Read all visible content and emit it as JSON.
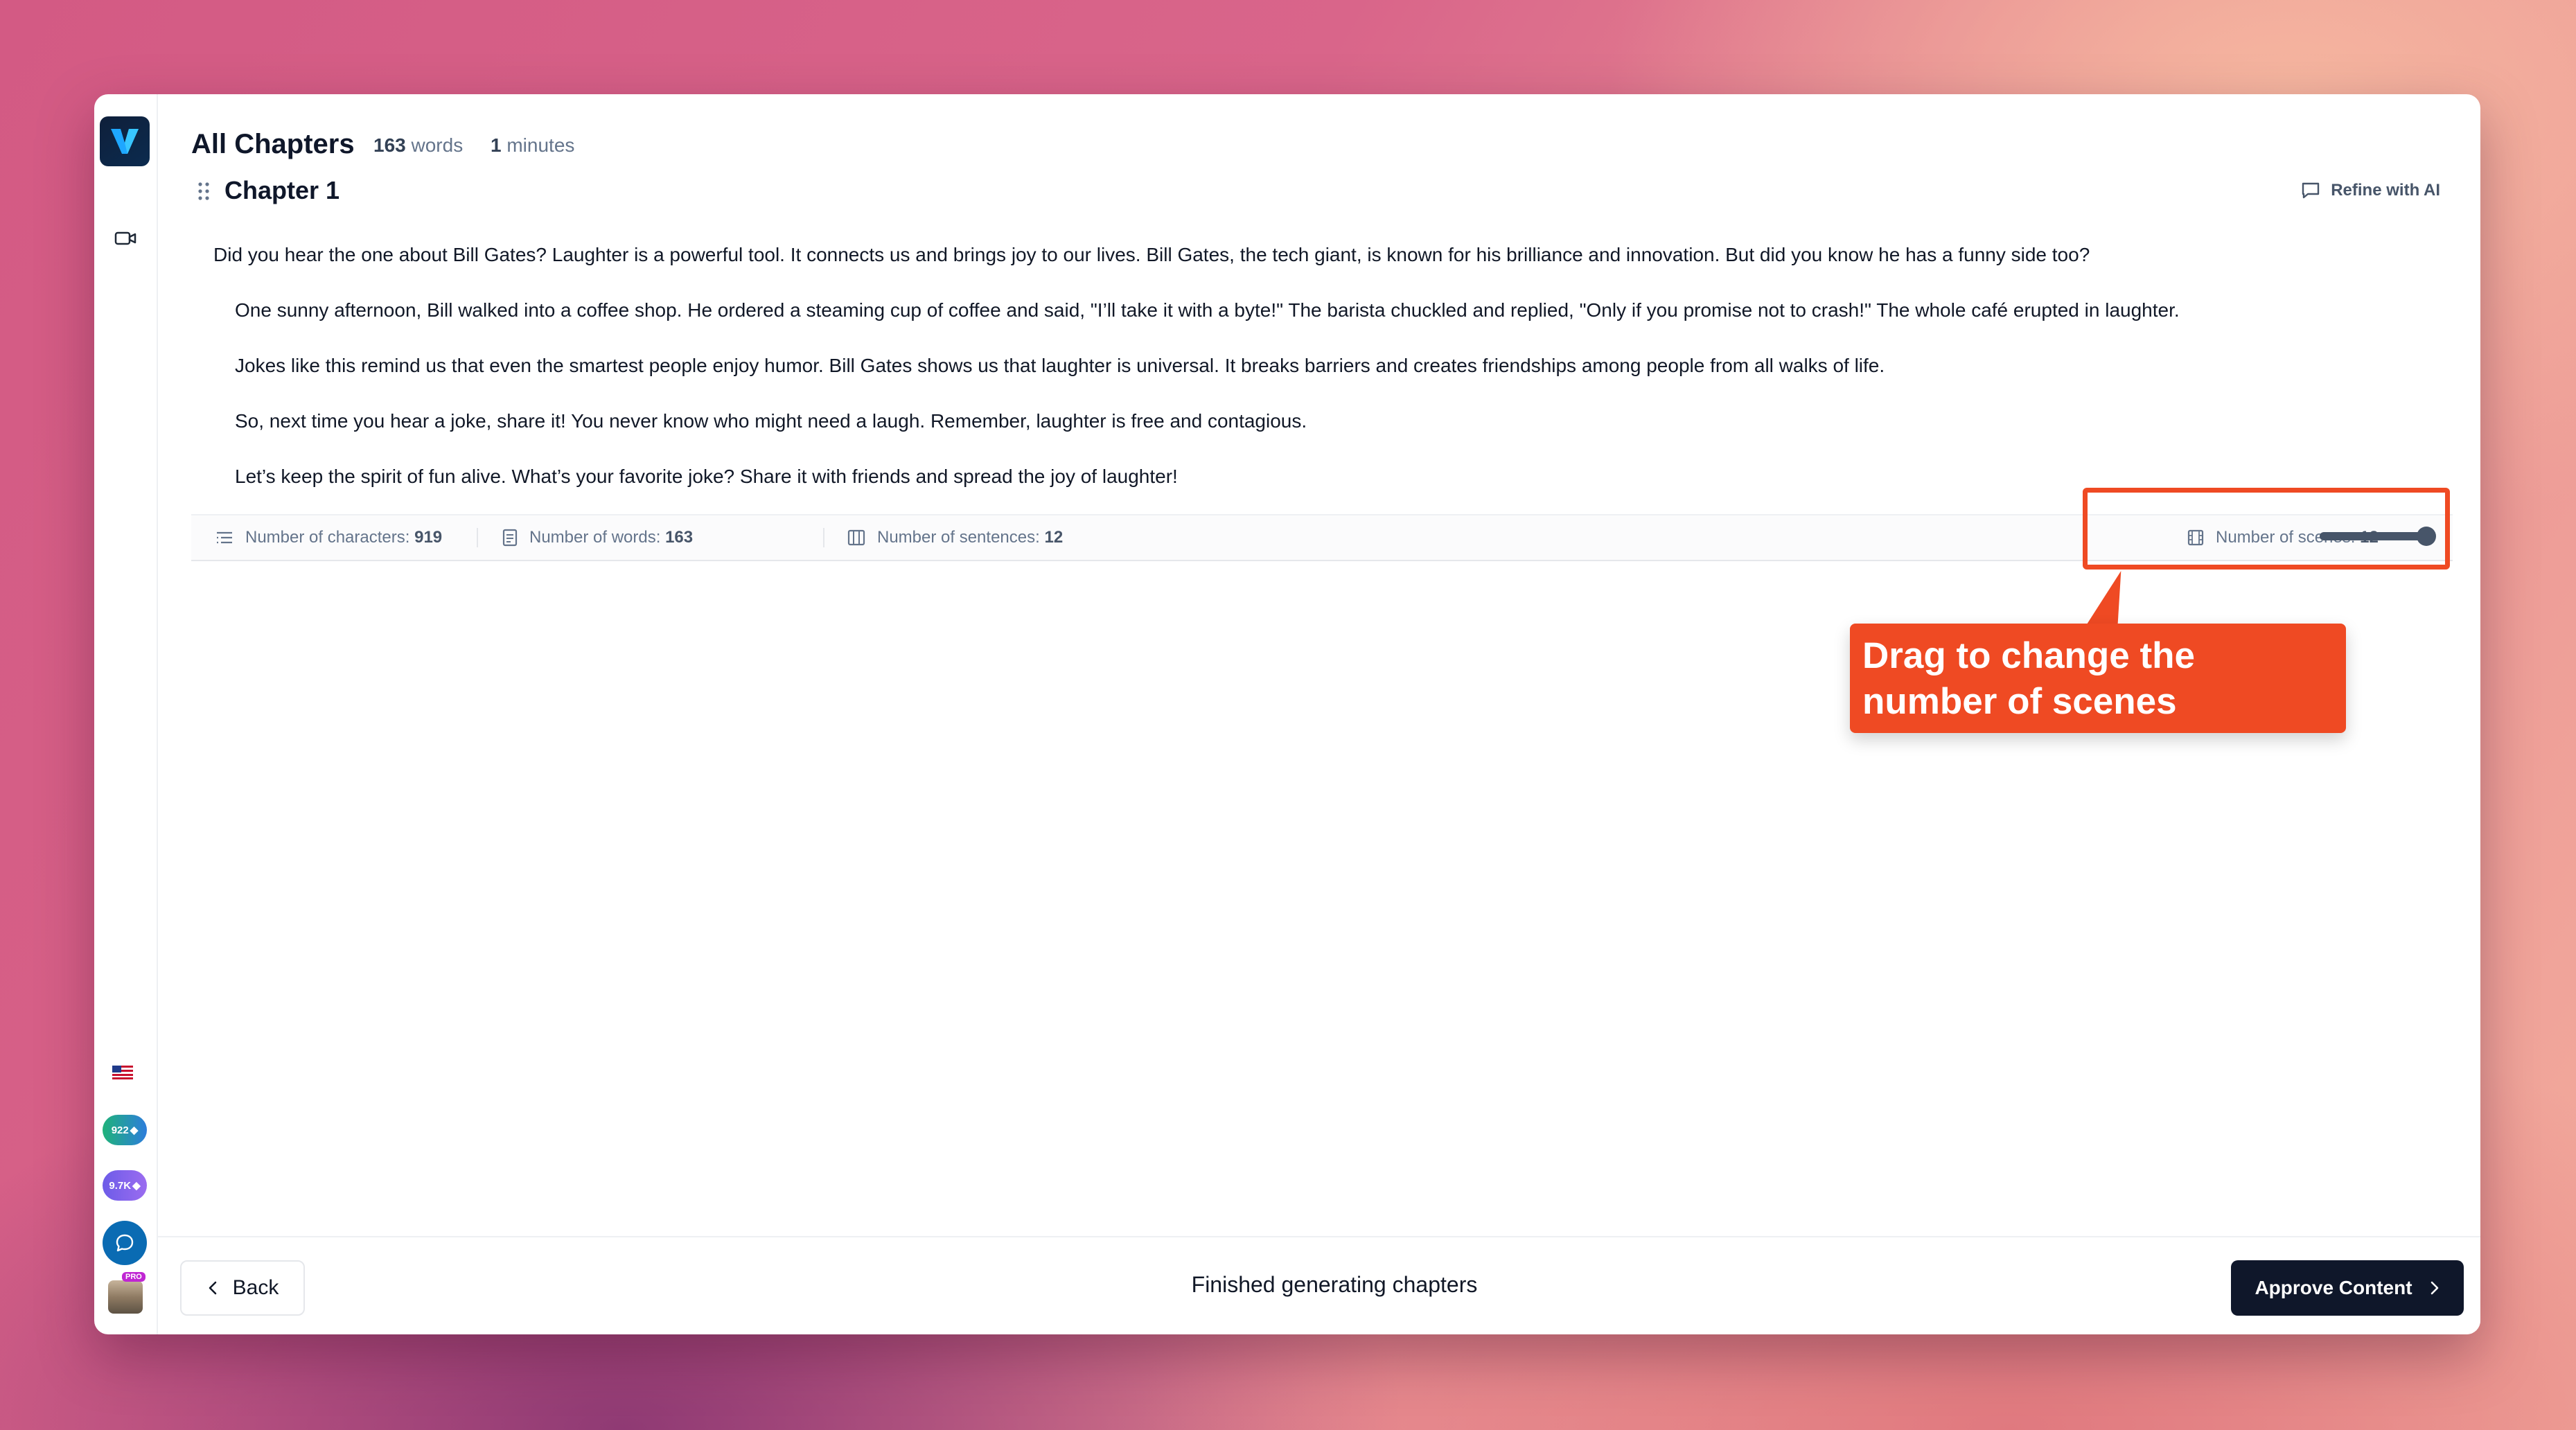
{
  "header": {
    "title": "All Chapters",
    "word_count": "163",
    "word_unit": "words",
    "minutes": "1",
    "minutes_unit": "minutes"
  },
  "chapter": {
    "title": "Chapter 1",
    "refine_label": "Refine with AI",
    "paragraphs": [
      "Did you hear the one about Bill Gates? Laughter is a powerful tool. It connects us and brings joy to our lives. Bill Gates, the tech giant, is known for his brilliance and innovation. But did you know he has a funny side too?",
      "One sunny afternoon, Bill walked into a coffee shop. He ordered a steaming cup of coffee and said, \"I’ll take it with a byte!\" The barista chuckled and replied, \"Only if you promise not to crash!\" The whole café erupted in laughter.",
      "Jokes like this remind us that even the smartest people enjoy humor. Bill Gates shows us that laughter is universal. It breaks barriers and creates friendships among people from all walks of life.",
      "So, next time you hear a joke, share it! You never know who might need a laugh. Remember, laughter is free and contagious.",
      "Let’s keep the spirit of fun alive. What’s your favorite joke? Share it with friends and spread the joy of laughter!"
    ]
  },
  "stats": {
    "characters_label": "Number of characters:",
    "characters_value": "919",
    "words_label": "Number of words:",
    "words_value": "163",
    "sentences_label": "Number of sentences:",
    "sentences_value": "12",
    "scenes_label": "Number of scenes:",
    "scenes_value": "12",
    "scenes_slider_fraction": 1.0
  },
  "annotation": {
    "text": "Drag to change the number of scenes",
    "color": "#ef4a23"
  },
  "sidebar": {
    "flag_icon": "us-flag-icon",
    "credits_1": "922",
    "credits_2": "9.7K",
    "pro_badge": "PRO"
  },
  "footer": {
    "back_label": "Back",
    "status": "Finished generating chapters",
    "approve_label": "Approve Content"
  },
  "colors": {
    "primary_dark": "#0f172a",
    "accent_red": "#ef4a23",
    "brand_blue": "#0a6bb3"
  }
}
